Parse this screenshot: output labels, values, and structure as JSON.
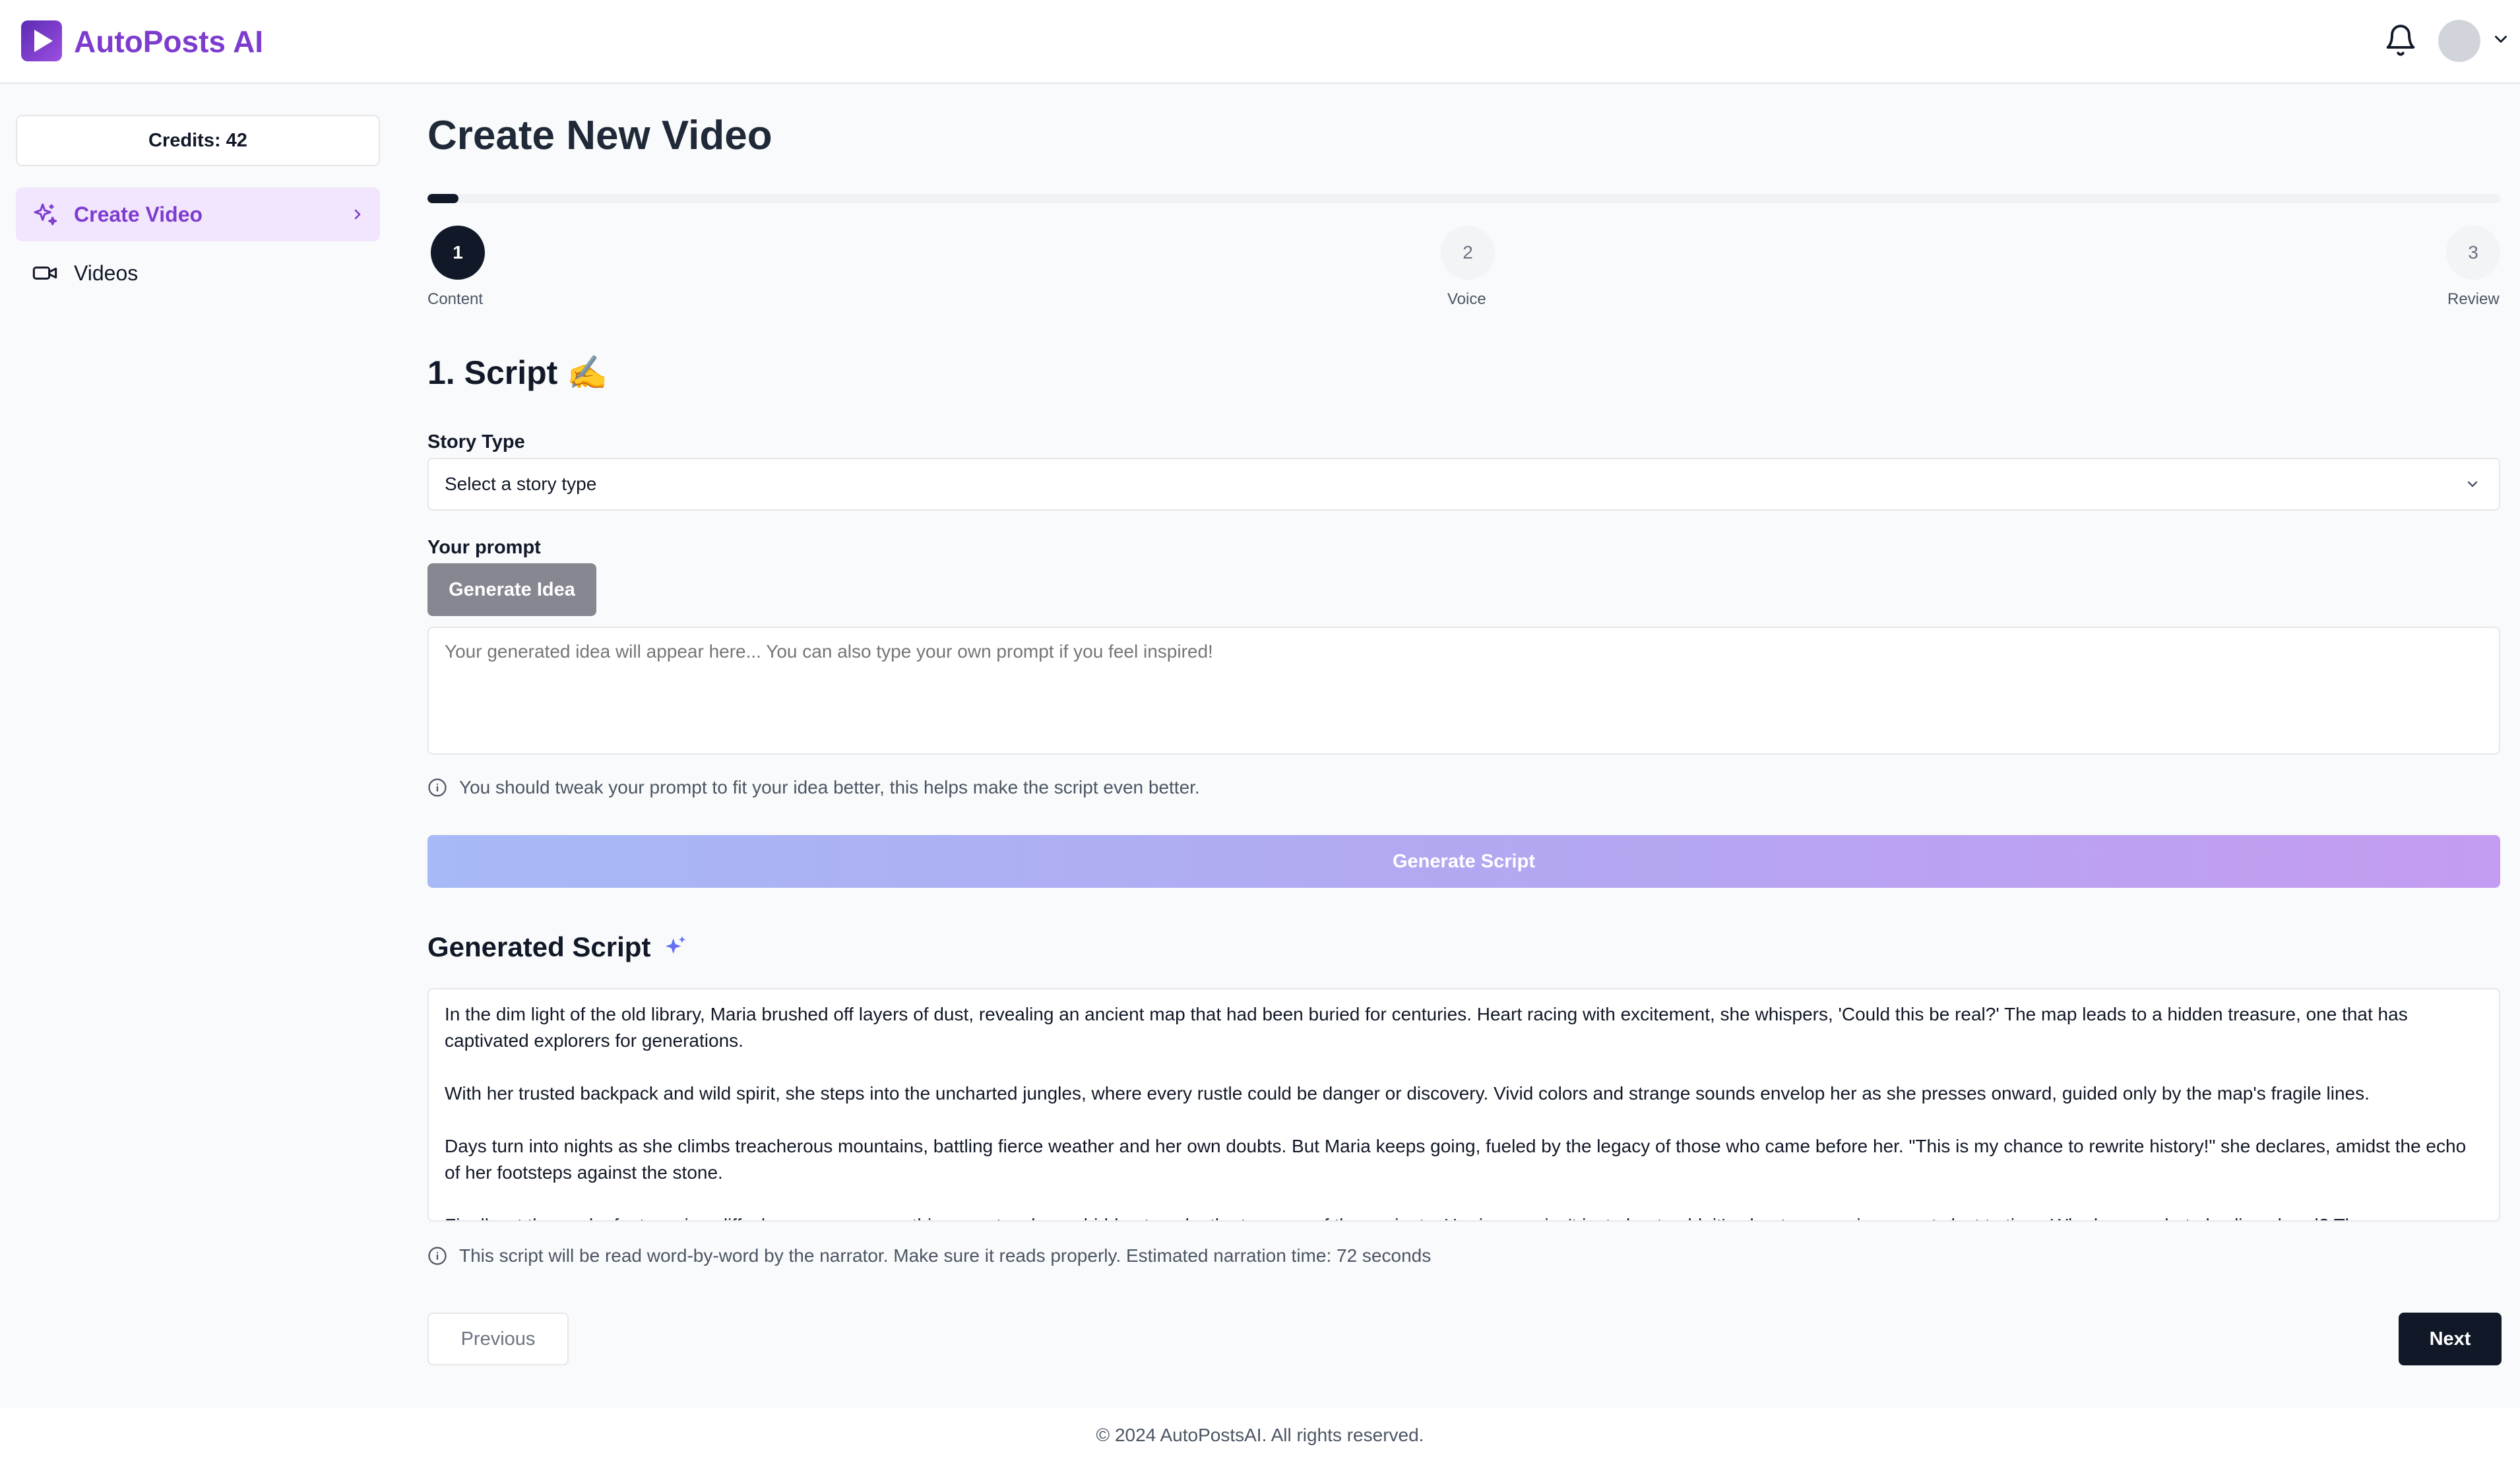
{
  "app": {
    "brand_name": "AutoPosts AI",
    "brand_color": "#7e3ccf"
  },
  "header": {
    "notification_icon": "bell-icon",
    "avatar_icon": "avatar",
    "avatar_menu_icon": "chevron-down-icon"
  },
  "sidebar": {
    "credits_label": "Credits: 42",
    "items": [
      {
        "label": "Create Video",
        "icon": "sparkle-icon",
        "active": true
      },
      {
        "label": "Videos",
        "icon": "video-camera-icon",
        "active": false
      }
    ]
  },
  "main": {
    "title": "Create New Video",
    "progress_fraction": 0.015,
    "steps": [
      {
        "number": "1",
        "label": "Content",
        "state": "current"
      },
      {
        "number": "2",
        "label": "Voice",
        "state": "todo"
      },
      {
        "number": "3",
        "label": "Review",
        "state": "todo"
      }
    ],
    "section_title": "1. Script ✍️",
    "story_type": {
      "label": "Story Type",
      "selected_value": "Select a story type"
    },
    "prompt": {
      "label": "Your prompt",
      "generate_idea_label": "Generate Idea",
      "placeholder": "Your generated idea will appear here... You can also type your own prompt if you feel inspired!",
      "value": "",
      "hint": "You should tweak your prompt to fit your idea better, this helps make the script even better."
    },
    "generate_script_label": "Generate Script",
    "generated_script": {
      "title": "Generated Script",
      "paragraphs": [
        "In the dim light of the old library, Maria brushed off layers of dust, revealing an ancient map that had been buried for centuries. Heart racing with excitement, she whispers, 'Could this be real?' The map leads to a hidden treasure, one that has captivated explorers for generations.",
        "With her trusted backpack and wild spirit, she steps into the uncharted jungles, where every rustle could be danger or discovery. Vivid colors and strange sounds envelop her as she presses onward, guided only by the map's fragile lines.",
        "Days turn into nights as she climbs treacherous mountains, battling fierce weather and her own doubts. But Maria keeps going, fueled by the legacy of those who came before her. \"This is my chance to rewrite history!\" she declares, amidst the echo of her footsteps against the stone.",
        "Finally, at the peak of a towering cliff, she uncovers something spectacular - a hidden temple, the treasure of the ancients. Her journey isn't just about gold; it's about uncovering secrets lost to time. Who knows what else lies ahead? The"
      ],
      "hint": "This script will be read word-by-word by the narrator. Make sure it reads properly. Estimated narration time: 72 seconds"
    },
    "previous_label": "Previous",
    "next_label": "Next"
  },
  "footer": {
    "copyright": "© 2024 AutoPostsAI. All rights reserved."
  }
}
